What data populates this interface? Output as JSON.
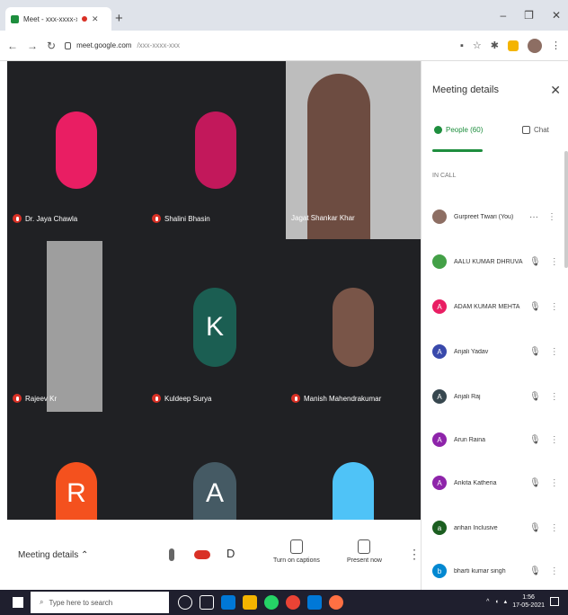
{
  "browser": {
    "tab_title": "Meet - xxx-xxxx-xxx",
    "url_host": "meet.google.com",
    "url_path": "/xxx-xxxx-xxx"
  },
  "tiles": [
    {
      "name": "Dr. Jaya Chawla",
      "avatar_color": "#e91e63",
      "kind": "photo-circle"
    },
    {
      "name": "Shalini Bhasin",
      "avatar_color": "#c2185b",
      "kind": "photo-circle"
    },
    {
      "name": "Jagat Shankar Khar",
      "kind": "video"
    },
    {
      "name": "Rajeev Kr",
      "kind": "video"
    },
    {
      "name": "Kuldeep Surya",
      "avatar_letter": "K",
      "avatar_color": "#1b5e52",
      "kind": "letter"
    },
    {
      "name": "Manish Mahendrakumar",
      "avatar_color": "#795548",
      "kind": "photo-circle"
    },
    {
      "name": "",
      "avatar_letter": "R",
      "avatar_color": "#f4511e",
      "kind": "letter"
    },
    {
      "name": "",
      "avatar_letter": "A",
      "avatar_color": "#455a64",
      "kind": "letter"
    },
    {
      "name": "",
      "avatar_color": "#4fc3f7",
      "kind": "photo-circle"
    }
  ],
  "controls": {
    "meeting_details": "Meeting details",
    "captions": "Turn on captions",
    "present": "Present now"
  },
  "panel": {
    "title": "Meeting details",
    "people_tab": "People (60)",
    "chat_tab": "Chat",
    "in_call": "IN CALL",
    "participants": [
      {
        "name": "Gurpreet Tiwari (You)",
        "color": "#8d6e63",
        "letter": ""
      },
      {
        "name": "AALU KUMAR DHRUVA",
        "color": "#43a047",
        "letter": ""
      },
      {
        "name": "ADAM KUMAR MEHTA",
        "color": "#e91e63",
        "letter": "A"
      },
      {
        "name": "Anjali Yadav",
        "color": "#3949ab",
        "letter": "A"
      },
      {
        "name": "Anjali Raj",
        "color": "#37474f",
        "letter": "A"
      },
      {
        "name": "Arun Raina",
        "color": "#8e24aa",
        "letter": "A"
      },
      {
        "name": "Ankita Katheria",
        "color": "#8e24aa",
        "letter": "A"
      },
      {
        "name": "arihan Inclusive",
        "color": "#1b5e20",
        "letter": "a"
      },
      {
        "name": "bharti kumar singh",
        "color": "#0288d1",
        "letter": "b"
      }
    ]
  },
  "taskbar": {
    "search_placeholder": "Type here to search",
    "time": "1:56",
    "date": "17-05-2021"
  },
  "colors": {
    "accent": "#1e8e3e",
    "danger": "#d93025",
    "stage": "#202124"
  }
}
